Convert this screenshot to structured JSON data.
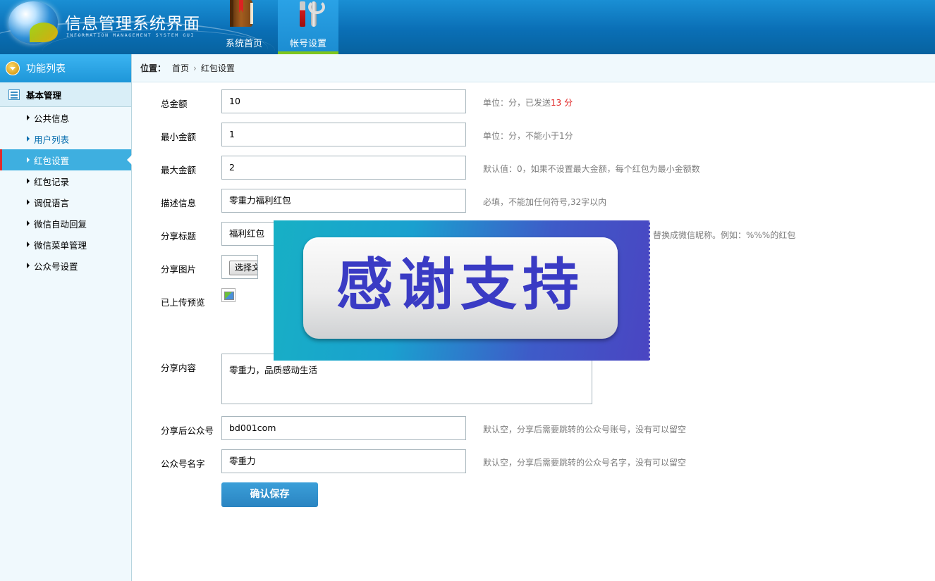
{
  "header": {
    "title": "信息管理系统界面",
    "subtitle": "INFORMATION MANAGEMENT SYSTEM GUI",
    "nav": [
      {
        "label": "系统首页",
        "icon": "book-icon"
      },
      {
        "label": "帐号设置",
        "icon": "tools-icon",
        "active": true
      }
    ]
  },
  "sidebar": {
    "header": "功能列表",
    "group": "基本管理",
    "items": [
      {
        "label": "公共信息"
      },
      {
        "label": "用户列表",
        "state": "hover"
      },
      {
        "label": "红包设置",
        "state": "active"
      },
      {
        "label": "红包记录"
      },
      {
        "label": "调侃语言"
      },
      {
        "label": "微信自动回复"
      },
      {
        "label": "微信菜单管理"
      },
      {
        "label": "公众号设置"
      }
    ]
  },
  "breadcrumb": {
    "label": "位置：",
    "items": [
      "首页",
      "红包设置"
    ],
    "separator": "›"
  },
  "form": {
    "total": {
      "label": "总金额",
      "value": "10",
      "hint_prefix": "单位：分，已发送",
      "hint_highlight": "13 分"
    },
    "min": {
      "label": "最小金额",
      "value": "1",
      "hint": "单位：分，不能小于1分"
    },
    "max": {
      "label": "最大金额",
      "value": "2",
      "hint": "默认值：0，如果不设置最大金额，每个红包为最小金额数"
    },
    "desc": {
      "label": "描述信息",
      "value": "零重力福利红包",
      "hint": "必填，不能加任何符号,32字以内"
    },
    "share_title": {
      "label": "分享标题",
      "value": "福利红包",
      "hint": "替换成微信昵称。例如：%%%的红包"
    },
    "share_image": {
      "label": "分享图片",
      "button": "选择文"
    },
    "preview": {
      "label": "已上传预览"
    },
    "share_content": {
      "label": "分享内容",
      "value": "零重力，品质感动生活"
    },
    "share_account": {
      "label": "分享后公众号",
      "value": "bd001com",
      "hint": "默认空，分享后需要跳转的公众号账号，没有可以留空"
    },
    "account_name": {
      "label": "公众号名字",
      "value": "零重力",
      "hint": "默认空，分享后需要跳转的公众号名字，没有可以留空"
    },
    "save_label": "确认保存"
  },
  "overlay": {
    "text": "感谢支持"
  },
  "colors": {
    "header_blue": "#0a6fb6",
    "sidebar_active": "#3eafe0",
    "active_marker": "#e12b2b",
    "nav_underline": "#7ec61c",
    "highlight_red": "#e02424",
    "button_blue": "#2a84c1"
  }
}
